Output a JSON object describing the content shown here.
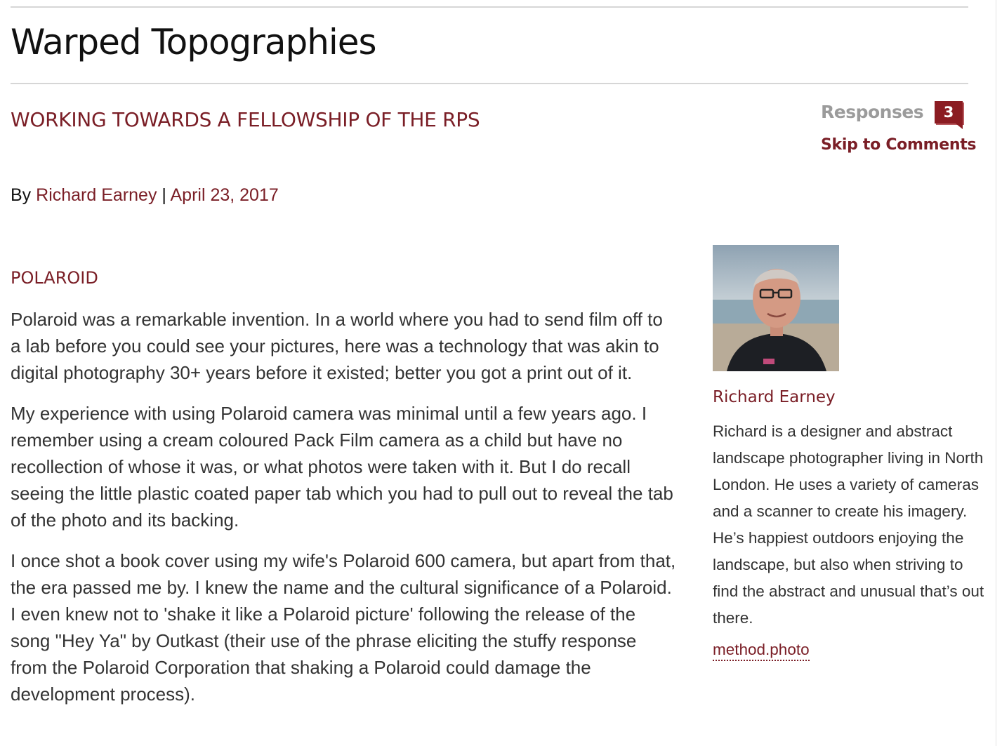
{
  "site": {
    "title": "Warped Topographies"
  },
  "post": {
    "category_heading": "WORKING TOWARDS A FELLOWSHIP OF THE RPS",
    "byline_prefix": "By",
    "author": "Richard Earney",
    "separator": "|",
    "date": "April 23, 2017",
    "subheading": "POLAROID",
    "paragraphs": [
      "Polaroid was a remarkable invention. In a world where you had to send film off to a lab before you could see your pictures, here was a technology that was akin to digital photography 30+ years before it existed; better you got a print out of it.",
      "My experience with using Polaroid camera was minimal until a few years ago. I remember using a cream coloured Pack Film camera as a child but have no recollection of whose it was, or what photos were taken with it. But I do recall seeing the little plastic coated paper tab which you had to pull out to reveal the tab of the photo and its backing.",
      "I once shot a book cover using my wife's Polaroid 600 camera, but apart from that, the era passed me by. I knew the name and the cultural significance of a Polaroid. I even knew not to 'shake it like a Polaroid picture' following the release of the song \"Hey Ya\" by Outkast (their use of the phrase eliciting the stuffy response from the Polaroid Corporation that shaking a Polaroid could damage the development process)."
    ]
  },
  "responses": {
    "label": "Responses",
    "count": "3",
    "skip_label": "Skip to Comments"
  },
  "author_box": {
    "name": "Richard Earney",
    "bio": "Richard is a designer and abstract landscape photographer living in North London. He uses a variety of cameras and a scanner to create his imagery. He’s happiest outdoors enjoying the landscape, but also when striving to find the abstract and unusual that’s out there.",
    "link": "method.photo",
    "photo_icon": "author-portrait"
  },
  "colors": {
    "accent": "#7a1e26",
    "badge": "#8b1c22",
    "muted": "#9b9b9b",
    "text": "#333333"
  }
}
